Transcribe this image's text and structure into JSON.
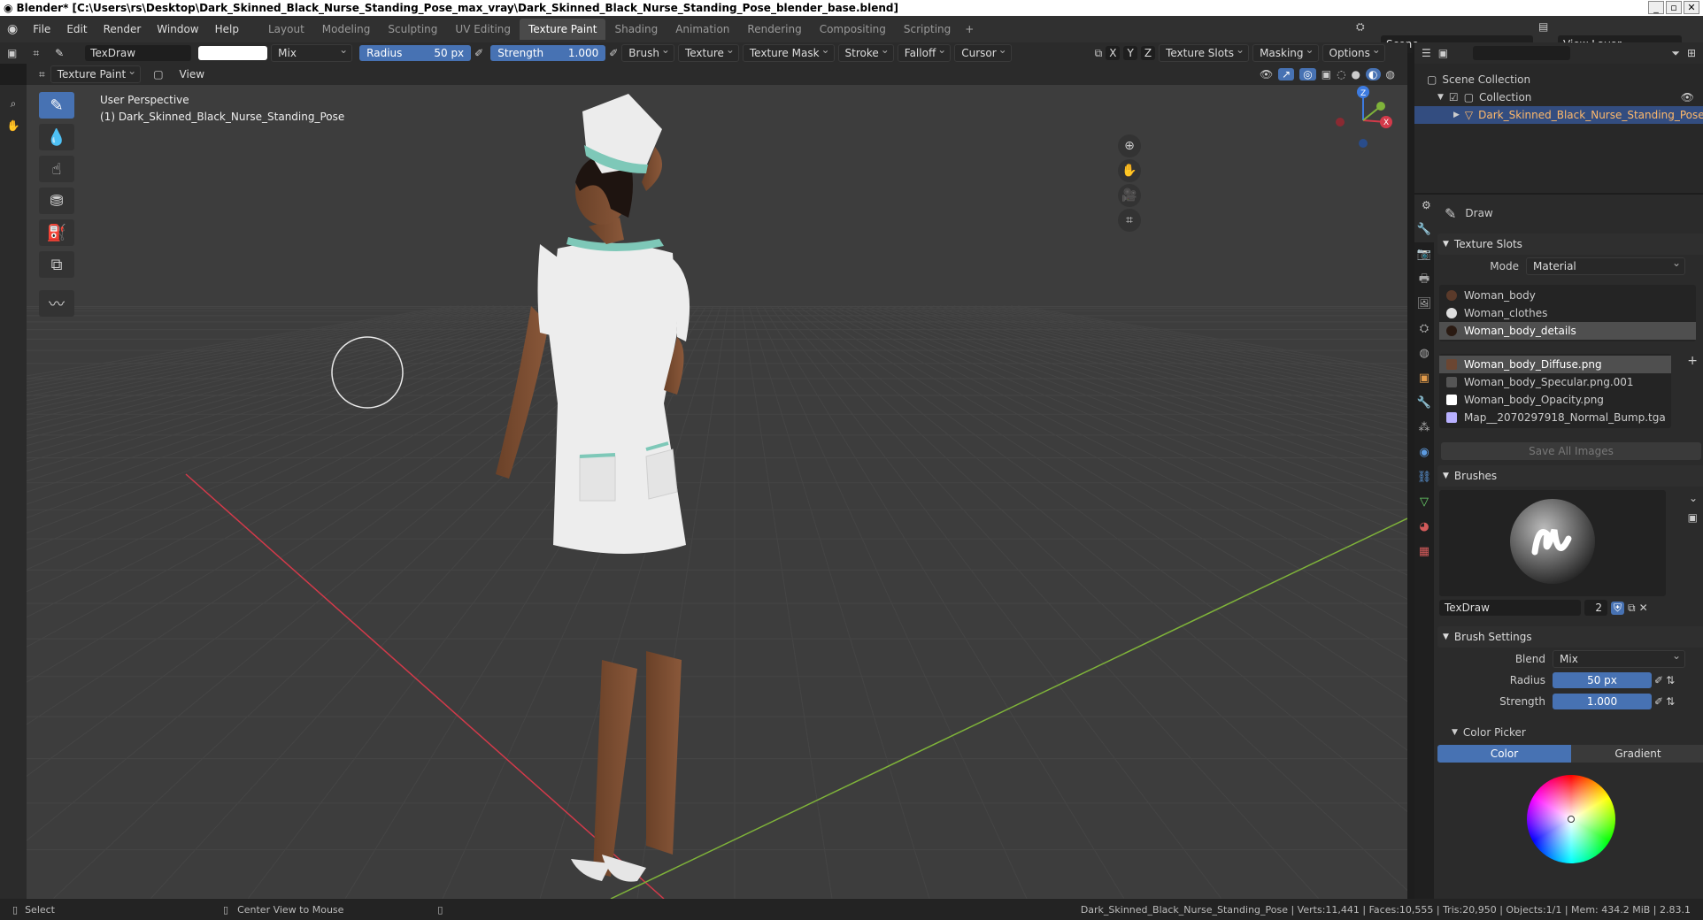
{
  "window": {
    "title": "Blender* [C:\\Users\\rs\\Desktop\\Dark_Skinned_Black_Nurse_Standing_Pose_max_vray\\Dark_Skinned_Black_Nurse_Standing_Pose_blender_base.blend]"
  },
  "menu": {
    "items": [
      "File",
      "Edit",
      "Render",
      "Window",
      "Help"
    ]
  },
  "workspaces": {
    "tabs": [
      "Layout",
      "Modeling",
      "Sculpting",
      "UV Editing",
      "Texture Paint",
      "Shading",
      "Animation",
      "Rendering",
      "Compositing",
      "Scripting"
    ],
    "active": "Texture Paint",
    "plus": "+"
  },
  "scene": {
    "name": "Scene",
    "view_layer": "View Layer"
  },
  "tool_header": {
    "brush_name": "TexDraw",
    "blend": "Mix",
    "radius_label": "Radius",
    "radius_value": "50 px",
    "strength_label": "Strength",
    "strength_value": "1.000",
    "menus": [
      "Brush",
      "Texture",
      "Texture Mask",
      "Stroke",
      "Falloff",
      "Cursor"
    ],
    "axes": [
      "X",
      "Y",
      "Z"
    ],
    "right_menus": [
      "Texture Slots",
      "Masking",
      "Options"
    ]
  },
  "view_header": {
    "mode": "Texture Paint",
    "view": "View"
  },
  "viewport": {
    "perspective": "User Perspective",
    "object_label": "(1) Dark_Skinned_Black_Nurse_Standing_Pose",
    "gizmo_axes": [
      "X",
      "Y",
      "Z"
    ]
  },
  "outliner": {
    "root": "Scene Collection",
    "collection": "Collection",
    "object": "Dark_Skinned_Black_Nurse_Standing_Pose"
  },
  "properties": {
    "tool_name": "Draw",
    "texture_slots": {
      "title": "Texture Slots",
      "mode_label": "Mode",
      "mode_value": "Material",
      "materials": [
        {
          "name": "Woman_body",
          "selected": false
        },
        {
          "name": "Woman_clothes",
          "selected": false
        },
        {
          "name": "Woman_body_details",
          "selected": true
        }
      ],
      "images": [
        {
          "name": "Woman_body_Diffuse.png",
          "selected": true,
          "color": "#6b4632"
        },
        {
          "name": "Woman_body_Specular.png.001",
          "selected": false,
          "color": "#555555"
        },
        {
          "name": "Woman_body_Opacity.png",
          "selected": false,
          "color": "#ffffff"
        },
        {
          "name": "Map__2070297918_Normal_Bump.tga",
          "selected": false,
          "color": "#b8b0ff"
        }
      ],
      "save_all": "Save All Images"
    },
    "brushes": {
      "title": "Brushes",
      "brush_name": "TexDraw",
      "users": "2"
    },
    "brush_settings": {
      "title": "Brush Settings",
      "blend_label": "Blend",
      "blend_value": "Mix",
      "radius_label": "Radius",
      "radius_value": "50 px",
      "strength_label": "Strength",
      "strength_value": "1.000"
    },
    "color_picker": {
      "title": "Color Picker",
      "tabs": [
        "Color",
        "Gradient"
      ],
      "active": "Color"
    }
  },
  "statusbar": {
    "select": "Select",
    "center": "Center View to Mouse",
    "stats": "Dark_Skinned_Black_Nurse_Standing_Pose | Verts:11,441 | Faces:10,555 | Tris:20,950 | Objects:1/1 | Mem: 434.2 MiB | 2.83.1"
  },
  "colors": {
    "accent": "#4772b3",
    "selection": "#334d80",
    "viewport_bg": "#3d3d3d",
    "x_axis": "#d33a4a",
    "y_axis": "#7fb33a"
  }
}
